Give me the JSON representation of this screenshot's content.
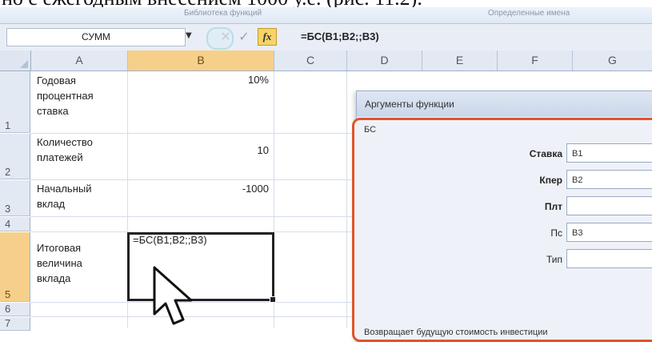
{
  "doc_text": "но с ежегодным внесением 1000 у.е. (рис. 11.2).",
  "ribbon": {
    "left_text": "Библиотека функций",
    "right_text": "Определенные имена"
  },
  "formula_bar": {
    "name_box": "СУММ",
    "formula": "=БС(B1;B2;;B3)"
  },
  "columns": [
    "A",
    "B",
    "C",
    "D",
    "E",
    "F",
    "G"
  ],
  "rows": [
    "1",
    "2",
    "3",
    "4",
    "5",
    "6",
    "7"
  ],
  "cells": {
    "a1": [
      "Годовая",
      "процентная",
      "ставка"
    ],
    "b1": "10%",
    "a2": [
      "Количество",
      "платежей"
    ],
    "b2": "10",
    "a3": [
      "Начальный",
      "вклад"
    ],
    "b3": "-1000",
    "a5": [
      "Итоговая",
      "величина",
      "вклада"
    ],
    "b5": "=БС(B1;B2;;B3)"
  },
  "dialog": {
    "title": "Аргументы функции",
    "function_name": "БС",
    "args": [
      {
        "label": "Ставка",
        "value": "B1",
        "bold": true
      },
      {
        "label": "Кпер",
        "value": "B2",
        "bold": true
      },
      {
        "label": "Плт",
        "value": "",
        "bold": true
      },
      {
        "label": "Пс",
        "value": "B3",
        "bold": false
      },
      {
        "label": "Тип",
        "value": "",
        "bold": false
      }
    ],
    "description": "Возвращает будущую стоимость инвестиции"
  },
  "colors": {
    "selected_header": "#f6d08a",
    "dialog_highlight": "#e2532a",
    "fx_button": "#f6d36a"
  }
}
